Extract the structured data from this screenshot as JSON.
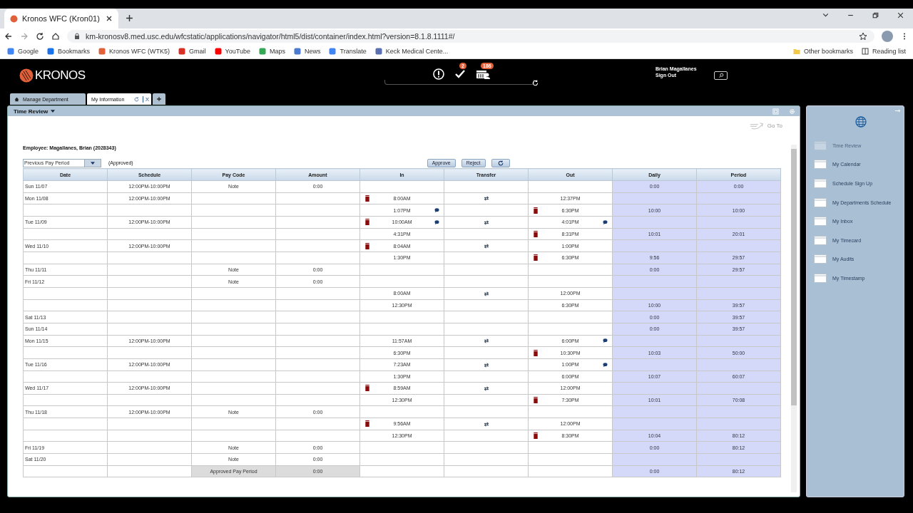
{
  "browser": {
    "tab_title": "Kronos WFC (Kron01)",
    "url": "km-kronosv8.med.usc.edu/wfcstatic/applications/navigator/html5/dist/container/index.html?version=8.1.8.1111#/",
    "bookmarks": [
      "Google",
      "Bookmarks",
      "Kronos WFC (WTK5)",
      "Gmail",
      "YouTube",
      "Maps",
      "News",
      "Translate",
      "Keck Medical Cente..."
    ],
    "other_bookmarks": "Other bookmarks",
    "reading_list": "Reading list"
  },
  "header": {
    "logo": "KRONOS",
    "approvals_badge": "2",
    "calendar_badge": "186",
    "user_name": "Brian Magallanes",
    "sign_out": "Sign Out"
  },
  "workspace_tabs": [
    {
      "label": "Manage Department",
      "selected": false
    },
    {
      "label": "My Information",
      "selected": true,
      "close": "X"
    }
  ],
  "time_review": {
    "title": "Time Review",
    "goto": "Go To",
    "employee": "Employee: Magallanes, Brian (2028343)",
    "period": "Previous Pay Period",
    "status": "(Approved)",
    "approve": "Approve",
    "reject": "Reject",
    "columns": [
      "Date",
      "Schedule",
      "Pay Code",
      "Amount",
      "In",
      "Transfer",
      "Out",
      "Daily",
      "Period"
    ],
    "rows": [
      {
        "kind": "day",
        "date": "Sun 11/07",
        "schedule": "12:00PM-10:00PM",
        "pay_code": "Note",
        "amount": "0:00",
        "in_flag": false,
        "in_comment": false,
        "transfer": false,
        "out_flag": false,
        "out_comment": false,
        "daily": "0:00",
        "period": "0:00"
      },
      {
        "kind": "day",
        "date": "Mon 11/08",
        "schedule": "12:00PM-10:00PM",
        "in": "8:00AM",
        "in_flag": true,
        "in_comment": false,
        "transfer": true,
        "out": "12:37PM",
        "out_flag": false,
        "out_comment": false
      },
      {
        "kind": "day",
        "in": "1:07PM",
        "in_flag": false,
        "in_comment": true,
        "transfer": false,
        "out": "6:30PM",
        "out_flag": true,
        "out_comment": false,
        "daily": "10:00",
        "period": "10:00"
      },
      {
        "kind": "day",
        "date": "Tue 11/09",
        "schedule": "12:00PM-10:00PM",
        "in": "10:00AM",
        "in_flag": true,
        "in_comment": true,
        "transfer": true,
        "out": "4:01PM",
        "out_flag": false,
        "out_comment": true
      },
      {
        "kind": "day",
        "in": "4:31PM",
        "in_flag": false,
        "in_comment": false,
        "transfer": false,
        "out": "8:31PM",
        "out_flag": true,
        "out_comment": false,
        "daily": "10:01",
        "period": "20:01"
      },
      {
        "kind": "day",
        "date": "Wed 11/10",
        "schedule": "12:00PM-10:00PM",
        "in": "8:04AM",
        "in_flag": true,
        "in_comment": false,
        "transfer": true,
        "out": "1:00PM",
        "out_flag": false,
        "out_comment": false
      },
      {
        "kind": "day",
        "in": "1:30PM",
        "in_flag": false,
        "in_comment": false,
        "transfer": false,
        "out": "6:30PM",
        "out_flag": true,
        "out_comment": false,
        "daily": "9:56",
        "period": "29:57"
      },
      {
        "kind": "day",
        "date": "Thu 11/11",
        "pay_code": "Note",
        "amount": "0:00",
        "in_flag": false,
        "in_comment": false,
        "transfer": false,
        "out_flag": false,
        "out_comment": false,
        "daily": "0:00",
        "period": "29:57"
      },
      {
        "kind": "day",
        "date": "Fri 11/12",
        "pay_code": "Note",
        "amount": "0:00",
        "in_flag": false,
        "in_comment": false,
        "transfer": false,
        "out_flag": false,
        "out_comment": false
      },
      {
        "kind": "day",
        "in": "8:00AM",
        "in_flag": false,
        "in_comment": false,
        "transfer": true,
        "out": "12:00PM",
        "out_flag": false,
        "out_comment": false
      },
      {
        "kind": "day",
        "in": "12:30PM",
        "in_flag": false,
        "in_comment": false,
        "transfer": false,
        "out": "6:30PM",
        "out_flag": false,
        "out_comment": false,
        "daily": "10:00",
        "period": "39:57"
      },
      {
        "kind": "day",
        "date": "Sat 11/13",
        "in_flag": false,
        "in_comment": false,
        "transfer": false,
        "out_flag": false,
        "out_comment": false,
        "daily": "0:00",
        "period": "39:57"
      },
      {
        "kind": "day",
        "date": "Sun 11/14",
        "in_flag": false,
        "in_comment": false,
        "transfer": false,
        "out_flag": false,
        "out_comment": false,
        "daily": "0:00",
        "period": "39:57"
      },
      {
        "kind": "day",
        "date": "Mon 11/15",
        "schedule": "12:00PM-10:00PM",
        "in": "11:57AM",
        "in_flag": false,
        "in_comment": false,
        "transfer": true,
        "out": "6:00PM",
        "out_flag": false,
        "out_comment": true
      },
      {
        "kind": "day",
        "in": "6:30PM",
        "in_flag": false,
        "in_comment": false,
        "transfer": false,
        "out": "10:30PM",
        "out_flag": true,
        "out_comment": false,
        "daily": "10:03",
        "period": "50:00"
      },
      {
        "kind": "day",
        "date": "Tue 11/16",
        "schedule": "12:00PM-10:00PM",
        "in": "7:23AM",
        "in_flag": false,
        "in_comment": false,
        "transfer": true,
        "out": "1:00PM",
        "out_flag": false,
        "out_comment": true
      },
      {
        "kind": "day",
        "in": "1:30PM",
        "in_flag": false,
        "in_comment": false,
        "transfer": false,
        "out": "6:00PM",
        "out_flag": false,
        "out_comment": false,
        "daily": "10:07",
        "period": "60:07"
      },
      {
        "kind": "day",
        "date": "Wed 11/17",
        "schedule": "12:00PM-10:00PM",
        "in": "8:59AM",
        "in_flag": true,
        "in_comment": false,
        "transfer": true,
        "out": "12:00PM",
        "out_flag": false,
        "out_comment": false
      },
      {
        "kind": "day",
        "in": "12:30PM",
        "in_flag": false,
        "in_comment": false,
        "transfer": false,
        "out": "7:30PM",
        "out_flag": true,
        "out_comment": false,
        "daily": "10:01",
        "period": "70:08"
      },
      {
        "kind": "day",
        "date": "Thu 11/18",
        "schedule": "12:00PM-10:00PM",
        "pay_code": "Note",
        "amount": "0:00",
        "in_flag": false,
        "in_comment": false,
        "transfer": false,
        "out_flag": false,
        "out_comment": false
      },
      {
        "kind": "day",
        "in": "9:56AM",
        "in_flag": true,
        "in_comment": false,
        "transfer": true,
        "out": "12:00PM",
        "out_flag": false,
        "out_comment": false
      },
      {
        "kind": "day",
        "in": "12:30PM",
        "in_flag": false,
        "in_comment": false,
        "transfer": false,
        "out": "8:30PM",
        "out_flag": true,
        "out_comment": false,
        "daily": "10:04",
        "period": "80:12"
      },
      {
        "kind": "day",
        "date": "Fri 11/19",
        "pay_code": "Note",
        "amount": "0:00",
        "in_flag": false,
        "in_comment": false,
        "transfer": false,
        "out_flag": false,
        "out_comment": false,
        "daily": "0:00",
        "period": "80:12"
      },
      {
        "kind": "day",
        "date": "Sat 11/20",
        "pay_code": "Note",
        "amount": "0:00",
        "in_flag": false,
        "in_comment": false,
        "transfer": false,
        "out_flag": false,
        "out_comment": false
      },
      {
        "kind": "total",
        "pay_code": "Approved Pay Period",
        "amount": "0:00",
        "in_flag": false,
        "in_comment": false,
        "transfer": false,
        "out_flag": false,
        "out_comment": false,
        "daily": "0:00",
        "period": "80:12"
      }
    ]
  },
  "sidebar": {
    "items": [
      {
        "label": "Time Review",
        "disabled": true
      },
      {
        "label": "My Calendar",
        "disabled": false
      },
      {
        "label": "Schedule Sign Up",
        "disabled": false
      },
      {
        "label": "My Departments Schedule",
        "disabled": false
      },
      {
        "label": "My Inbox",
        "disabled": false
      },
      {
        "label": "My Timecard",
        "disabled": false
      },
      {
        "label": "My Audits",
        "disabled": false
      },
      {
        "label": "My Timestamp",
        "disabled": false
      }
    ]
  }
}
